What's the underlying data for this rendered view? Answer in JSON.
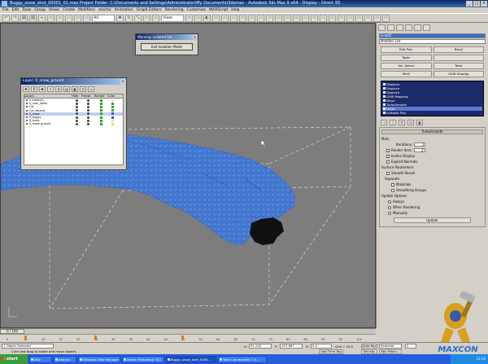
{
  "window": {
    "title": "Buggy_snow_shot_00001_01.max    Project Folder: C:\\Documents and Settings\\Administrator\\My Documents\\3dsmax    - Autodesk 3ds Max 9 x64    - Display : Direct 3D",
    "btn_min": "_",
    "btn_max": "□",
    "btn_close": "×"
  },
  "menu": [
    "File",
    "Edit",
    "Tools",
    "Group",
    "Views",
    "Create",
    "Modifiers",
    "reactor",
    "Animation",
    "Graph Editors",
    "Rendering",
    "Customize",
    "MAXScript",
    "Help"
  ],
  "toolbar": {
    "buttons": [
      "↶",
      "↷",
      "⛓",
      "⛓",
      "≈",
      "▭",
      "▭",
      "▭",
      "▭",
      "▭",
      "✥",
      "↻",
      "⤡",
      "▭",
      "▭",
      "▭",
      "▭",
      "◐",
      "▭",
      "▭",
      "▭",
      "▭",
      "▭",
      "▭",
      "▭",
      "▭",
      "▭",
      "▭",
      "▭",
      "▭",
      "▭",
      "▭",
      "▭",
      "▭",
      "▭",
      "▭",
      "▭",
      "▭"
    ],
    "selection_set": "All",
    "view_dropdown": "View"
  },
  "iso_dialog": {
    "title": "Warning: Isolated Sel...",
    "close": "×",
    "button": "Exit Isolation Mode"
  },
  "layer_manager": {
    "title": "Layer: 0_snow_ground",
    "close": "×",
    "tools": [
      "✚",
      "K",
      "✚",
      "+",
      "⊕",
      "▤",
      "▦",
      "⊟",
      "▭"
    ],
    "columns": [
      "Layers",
      "Hide",
      "Freeze",
      "Render",
      "Color"
    ],
    "rows": [
      {
        "name": "0 (default)",
        "color": "#e0e0e0",
        "selected": false
      },
      {
        "name": "0_cam_lights",
        "color": "#40a040",
        "selected": false
      },
      {
        "name": "Car",
        "color": "#40a040",
        "selected": false
      },
      {
        "name": "Car_wheels",
        "color": "#40a040",
        "selected": false
      },
      {
        "name": "0_snow",
        "color": "#4050c0",
        "selected": true
      },
      {
        "name": "0_buggy",
        "color": "#4050c0",
        "selected": false
      },
      {
        "name": "0_trees",
        "color": "#e0e0e0",
        "selected": false
      },
      {
        "name": "0_snow_ground",
        "color": "#e8e020",
        "selected": false
      }
    ]
  },
  "command_panel": {
    "object_name": "Line02",
    "modifier_list": "Modifier List",
    "buttons": [
      "Edit Poly",
      "Bend",
      "Taper",
      "",
      "Vol. Select",
      "Twist",
      "Shell",
      "UVW Unwrap"
    ],
    "stack": [
      "Displace",
      "Displace",
      "Displace",
      "UVW Mapping",
      "Noise",
      "TurboSmooth",
      "Noise",
      "Editable Poly"
    ],
    "stack_icons": [
      "⊣",
      "|",
      "∀",
      "⊡",
      "▦"
    ],
    "turbosmooth": {
      "title": "TurboSmooth",
      "main_label": "Main",
      "iterations_label": "Iterations:",
      "iterations": "1",
      "render_iters_label": "Render Iters:",
      "render_iters": "2",
      "isoline_display": "Isoline Display",
      "explicit_normals": "Explicit Normals",
      "surface_params_label": "Surface Parameters",
      "smooth_result": "Smooth Result",
      "separate_label": "Separate",
      "materials": "Materials",
      "smoothing_groups": "Smoothing Groups",
      "update_options_label": "Update Options",
      "always": "Always",
      "when_rendering": "When Rendering",
      "manually": "Manually",
      "update_button": "Update"
    }
  },
  "timeline": {
    "slider_label": "0 / 100",
    "ticks": [
      "0",
      "5",
      "10",
      "15",
      "20",
      "25",
      "30",
      "35",
      "40",
      "45",
      "50",
      "55",
      "60",
      "65",
      "70",
      "75",
      "80",
      "85",
      "90",
      "95",
      "100"
    ],
    "keyframes": [
      5,
      25,
      50
    ]
  },
  "status": {
    "selection": "1 Object Selected",
    "prompt": "Click and drag to select and move objects",
    "x_label": "X:",
    "x": "91.242",
    "y_label": "Y:",
    "y": "197.667",
    "z_label": "Z:",
    "z": "0.0",
    "grid": "Grid = 10.0",
    "add_time_tag": "Add Time Tag",
    "auto_key": "Auto Key",
    "selected": "Selected",
    "set_key": "Set Key",
    "key_filters": "Key Filters...",
    "frame": "0"
  },
  "taskbar": {
    "start": "start",
    "tasks": [
      "Wiki",
      "patman",
      "Windows Task Manager",
      "Adobe Photoshop CS3",
      "Buggy_snow_shot_0000...",
      "Total Commander 7.0..."
    ],
    "active_task": 4,
    "clock": "11:50"
  },
  "watermark": {
    "brand": "MAXCON",
    "icon": "hammer-mascot-icon"
  },
  "colors": {
    "snow": "#4a7fd6",
    "snow_dark": "#3562b8",
    "viewport_bg": "#7d7d7d"
  }
}
